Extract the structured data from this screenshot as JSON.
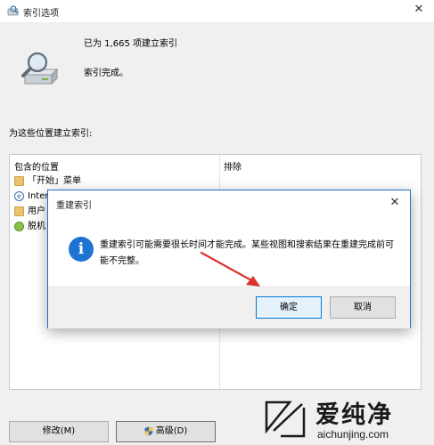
{
  "window": {
    "title": "索引选项",
    "close_glyph": "✕"
  },
  "status": {
    "indexed_count_text": "已为 1,665 项建立索引",
    "state_text": "索引完成。"
  },
  "locations_label": "为这些位置建立索引:",
  "table": {
    "col_included": "包含的位置",
    "col_excluded": "排除",
    "rows": [
      {
        "label": "「开始」菜单",
        "icon": "folder-icon"
      },
      {
        "label": "Inter",
        "icon": "internet-explorer-icon"
      },
      {
        "label": "用户",
        "icon": "folder-icon"
      },
      {
        "label": "脱机",
        "icon": "offline-files-icon"
      }
    ]
  },
  "buttons": {
    "modify": "修改(M)",
    "advanced": "高级(D)"
  },
  "dialog": {
    "title": "重建索引",
    "close_glyph": "✕",
    "info_glyph": "i",
    "message": "重建索引可能需要很长时间才能完成。某些视图和搜索结果在重建完成前可能不完整。",
    "ok": "确定",
    "cancel": "取消"
  },
  "watermark": {
    "brand_cn": "爱纯净",
    "url": "aichunjing.com"
  },
  "colors": {
    "dialog_border": "#2a6fc4",
    "info_icon": "#1f73d2",
    "arrow": "#d9342b",
    "focus_button_border": "#0078d7"
  }
}
